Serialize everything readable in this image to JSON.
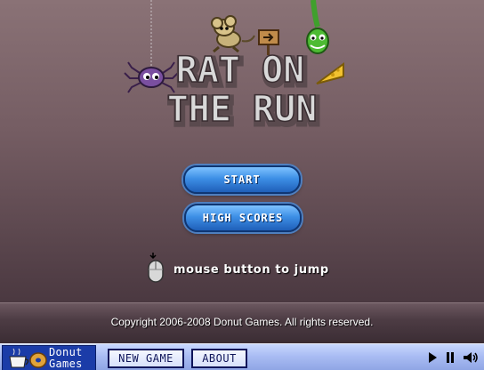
{
  "game": {
    "title_line1": "RAT ON",
    "title_line2": "THE RUN"
  },
  "menu": {
    "start_label": "START",
    "high_scores_label": "HIGH SCORES"
  },
  "hint": {
    "icon": "mouse-icon",
    "text": "mouse button to jump"
  },
  "footer": {
    "copyright": "Copyright 2006-2008 Donut Games. All rights reserved."
  },
  "bottom_bar": {
    "logo_line1": "Donut",
    "logo_line2": "Games",
    "new_game_label": "NEW GAME",
    "about_label": "ABOUT",
    "controls": [
      "play-icon",
      "pause-icon",
      "sound-icon"
    ]
  },
  "colors": {
    "background_top": "#8a7276",
    "background_bottom": "#3d2e35",
    "button_blue": "#3d8fe6",
    "bar_blue": "#a9bcf3",
    "logo_blue": "#1b3ca8"
  }
}
